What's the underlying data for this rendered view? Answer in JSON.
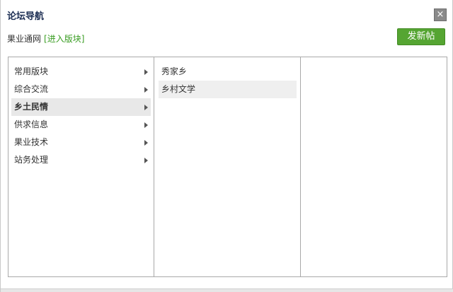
{
  "dialog": {
    "title": "论坛导航",
    "close_label": "×"
  },
  "breadcrumb": {
    "forum_name": "果业通网",
    "enter_label": "[进入版块]"
  },
  "post_button_label": "发新帖",
  "categories": [
    {
      "label": "常用版块",
      "active": false
    },
    {
      "label": "综合交流",
      "active": false
    },
    {
      "label": "乡土民情",
      "active": true
    },
    {
      "label": "供求信息",
      "active": false
    },
    {
      "label": "果业技术",
      "active": false
    },
    {
      "label": "站务处理",
      "active": false
    }
  ],
  "subcategories": [
    {
      "label": "秀家乡",
      "selected": false
    },
    {
      "label": "乡村文学",
      "selected": true
    }
  ]
}
